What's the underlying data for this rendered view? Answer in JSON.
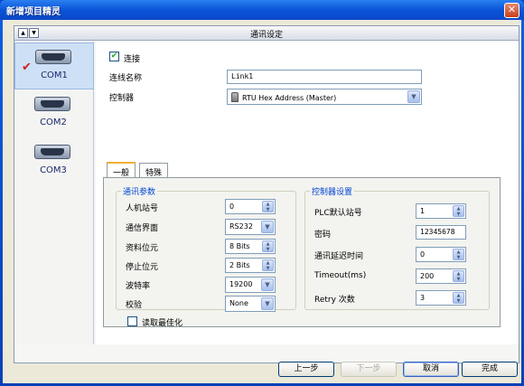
{
  "window": {
    "title": "新增项目精灵",
    "close_glyph": "✕"
  },
  "panel": {
    "header_title": "通讯设定",
    "nav_up": "▲",
    "nav_down": "▼"
  },
  "ports": [
    {
      "label": "COM1",
      "icon": "serial-port-icon",
      "selected": true,
      "checked": "✔"
    },
    {
      "label": "COM2",
      "icon": "serial-port-icon",
      "selected": false
    },
    {
      "label": "COM3",
      "icon": "serial-port-icon",
      "selected": false
    }
  ],
  "form": {
    "connect_checkbox": {
      "label": "连接",
      "checked": true,
      "glyph": "✔"
    },
    "connection_name": {
      "label": "连线名称",
      "value": "Link1"
    },
    "controller": {
      "label": "控制器",
      "value": "RTU Hex Address (Master)",
      "icon": "rtu-device-icon"
    }
  },
  "tabs": [
    {
      "label": "一般",
      "active": true
    },
    {
      "label": "特殊",
      "active": false
    }
  ],
  "comm_params": {
    "title": "通讯参数",
    "fields": [
      {
        "label": "人机站号",
        "value": "0",
        "kind": "spin"
      },
      {
        "label": "通信界面",
        "value": "RS232",
        "kind": "select"
      },
      {
        "label": "资料位元",
        "value": "8 Bits",
        "kind": "spin"
      },
      {
        "label": "停止位元",
        "value": "2 Bits",
        "kind": "spin"
      },
      {
        "label": "波特率",
        "value": "19200",
        "kind": "select"
      },
      {
        "label": "校验",
        "value": "None",
        "kind": "select"
      }
    ]
  },
  "controller_settings": {
    "title": "控制器设置",
    "fields": [
      {
        "label": "PLC默认站号",
        "value": "1",
        "kind": "spin"
      },
      {
        "label": "密码",
        "value": "12345678",
        "kind": "text"
      },
      {
        "label": "通讯延迟时间",
        "value": "0",
        "kind": "spin"
      },
      {
        "label": "Timeout(ms)",
        "value": "200",
        "kind": "spin"
      },
      {
        "label": "Retry 次数",
        "value": "3",
        "kind": "spin"
      }
    ]
  },
  "optimize_checkbox": {
    "label": "读取最佳化",
    "checked": false
  },
  "buttons": {
    "prev": "上一步",
    "next": "下一步",
    "cancel": "取消",
    "finish": "完成"
  },
  "glyphs": {
    "spin": "▲\n▼",
    "dropdown": "▼"
  },
  "colors": {
    "titlebar": "#0a54d8",
    "selected_item": "#cde0f6",
    "group_title": "#0046d5"
  }
}
